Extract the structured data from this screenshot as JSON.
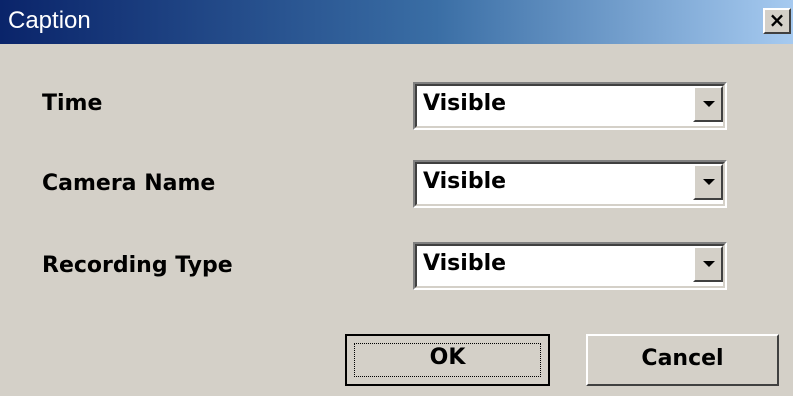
{
  "window": {
    "title": "Caption",
    "close_glyph": "×",
    "accent_color": "#0a246a"
  },
  "fields": [
    {
      "label": "Time",
      "value": "Visible",
      "icon": "chevron-down-icon"
    },
    {
      "label": "Camera Name",
      "value": "Visible",
      "icon": "chevron-down-icon"
    },
    {
      "label": "Recording Type",
      "value": "Visible",
      "icon": "chevron-down-icon"
    }
  ],
  "buttons": {
    "ok_label": "OK",
    "cancel_label": "Cancel"
  }
}
